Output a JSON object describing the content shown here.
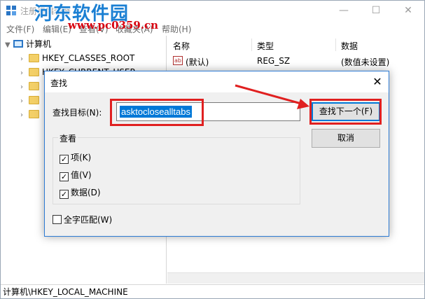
{
  "window": {
    "title": "注册表编辑器",
    "watermark": "河东软件园",
    "watermark_url": "www.pc0359.cn",
    "min_glyph": "—",
    "max_glyph": "☐",
    "close_glyph": "✕"
  },
  "menubar": {
    "items": [
      "文件(F)",
      "编辑(E)",
      "查看(V)",
      "收藏夹(A)",
      "帮助(H)"
    ]
  },
  "tree": {
    "root": "计算机",
    "items": [
      "HKEY_CLASSES_ROOT",
      "HKEY_CURRENT_USER"
    ]
  },
  "list": {
    "columns": [
      "名称",
      "类型",
      "数据"
    ],
    "rows": [
      {
        "name": "(默认)",
        "type": "REG_SZ",
        "data": "(数值未设置)"
      }
    ]
  },
  "statusbar": {
    "path": "计算机\\HKEY_LOCAL_MACHINE"
  },
  "dialog": {
    "title": "查找",
    "find_label": "查找目标(N):",
    "find_value": "asktoclosealltabs",
    "find_next_label": "查找下一个(F)",
    "cancel_label": "取消",
    "look_group_label": "查看",
    "look_options": [
      {
        "label": "项(K)",
        "checked": true
      },
      {
        "label": "值(V)",
        "checked": true
      },
      {
        "label": "数据(D)",
        "checked": true
      }
    ],
    "match_whole_label": "全字匹配(W)",
    "match_whole_checked": false
  },
  "colors": {
    "accent": "#0078d7",
    "annotation": "#e02020"
  }
}
